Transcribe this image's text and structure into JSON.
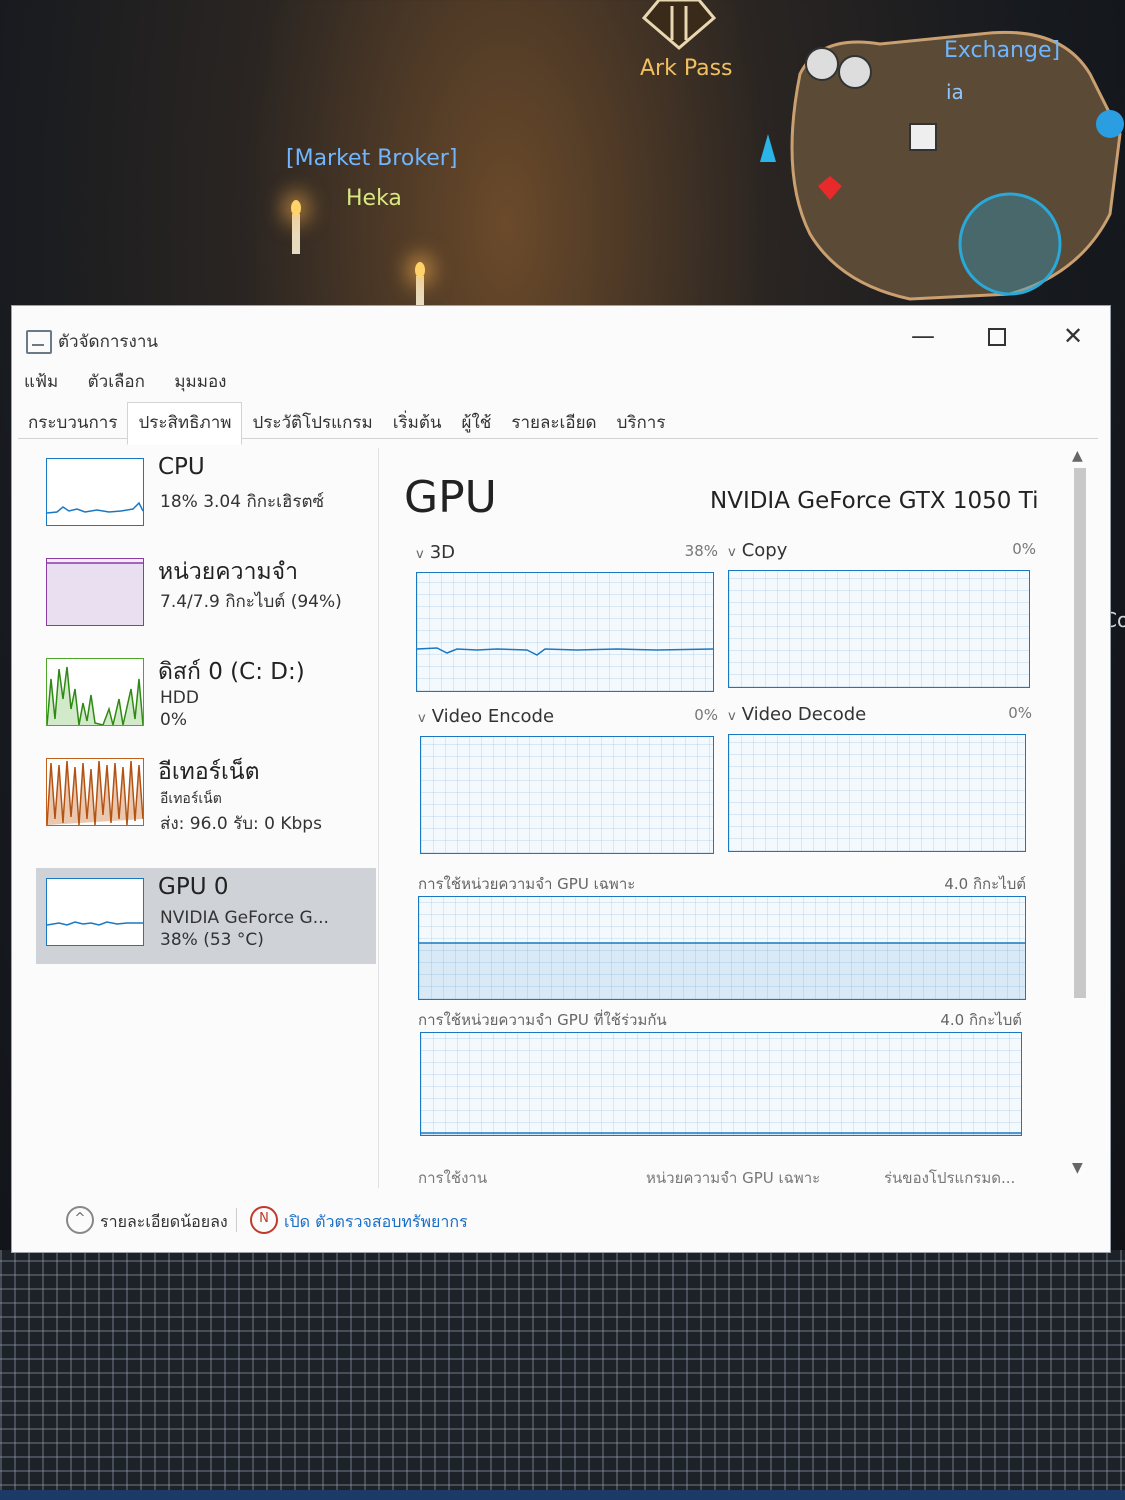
{
  "game": {
    "ark_pass": "Ark Pass",
    "market_broker": "[Market Broker]",
    "npc_name": "Heka",
    "exchange": "Exchange]",
    "map_fragment": "ia",
    "edge_text": "Co"
  },
  "window": {
    "title": "ตัวจัดการงาน",
    "controls": {
      "minimize": "—",
      "maximize": "",
      "close": "✕"
    }
  },
  "menu": [
    "แฟ้ม",
    "ตัวเลือก",
    "มุมมอง"
  ],
  "tabs": [
    "กระบวนการ",
    "ประสิทธิภาพ",
    "ประวัติโปรแกรม",
    "เริ่มต้น",
    "ผู้ใช้",
    "รายละเอียด",
    "บริการ"
  ],
  "active_tab": "ประสิทธิภาพ",
  "resources": [
    {
      "name": "CPU",
      "line1": "18%  3.04 กิกะเฮิรตซ์",
      "line2": "",
      "color": "#1a78c2"
    },
    {
      "name": "หน่วยความจำ",
      "line1": "7.4/7.9 กิกะไบต์ (94%)",
      "line2": "",
      "color": "#8b3aa8"
    },
    {
      "name": "ดิสก์ 0 (C: D:)",
      "line1": "HDD",
      "line2": "0%",
      "color": "#4da82a"
    },
    {
      "name": "อีเทอร์เน็ต",
      "line1": "อีเทอร์เน็ต",
      "line2": "ส่ง: 96.0  รับ: 0 Kbps",
      "color": "#c0601a"
    },
    {
      "name": "GPU 0",
      "line1": "NVIDIA GeForce G...",
      "line2": "38%  (53 °C)",
      "color": "#1a78c2"
    }
  ],
  "gpu": {
    "title": "GPU",
    "model": "NVIDIA GeForce GTX 1050 Ti",
    "engines": [
      {
        "label": "3D",
        "percent": "38%"
      },
      {
        "label": "Copy",
        "percent": "0%"
      },
      {
        "label": "Video Encode",
        "percent": "0%"
      },
      {
        "label": "Video Decode",
        "percent": "0%"
      }
    ],
    "dedicated_memory_label": "การใช้หน่วยความจำ GPU เฉพาะ",
    "dedicated_memory_max": "4.0 กิกะไบต์",
    "shared_memory_label": "การใช้หน่วยความจำ GPU ที่ใช้ร่วมกัน",
    "shared_memory_max": "4.0 กิกะไบต์",
    "bottom_columns": [
      "การใช้งาน",
      "หน่วยความจำ GPU เฉพาะ",
      "ร่นของโปรแกรมด..."
    ]
  },
  "footer": {
    "less_details": "รายละเอียดน้อยลง",
    "open_monitor": "เปิด ตัวตรวจสอบทรัพยากร",
    "link_color": "#1a6fc9"
  }
}
